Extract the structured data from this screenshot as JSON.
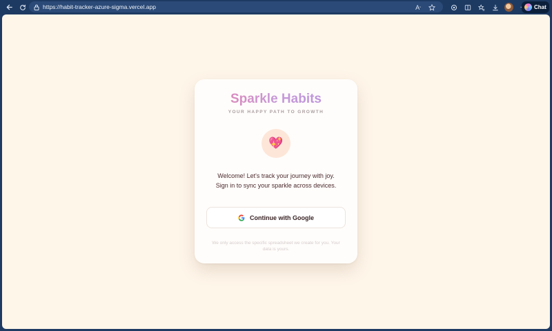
{
  "browser": {
    "url": "https://habit-tracker-azure-sigma.vercel.app",
    "chat_label": "Chat",
    "icons": [
      "back-icon",
      "refresh-icon",
      "lock-icon",
      "read-aloud-icon",
      "favorite-star-icon",
      "extensions-icon",
      "split-screen-icon",
      "favorites-icon",
      "downloads-icon",
      "profile-avatar",
      "more-icon",
      "copilot-icon"
    ]
  },
  "card": {
    "title": "Sparkle Habits",
    "subtitle": "YOUR HAPPY PATH TO GROWTH",
    "emoji": "💖",
    "welcome_line1": "Welcome! Let's track your journey with joy.",
    "welcome_line2": "Sign in to sync your sparkle across devices.",
    "google_button_label": "Continue with Google",
    "footnote": "We only access the specific spreadsheet we create for you. Your data is yours."
  },
  "colors": {
    "page_background": "#fff6ea",
    "title_gradient_start": "#e77faa",
    "title_gradient_end": "#b58fe0",
    "emoji_circle": "#fde6d8",
    "browser_chrome": "#1d3a62"
  }
}
